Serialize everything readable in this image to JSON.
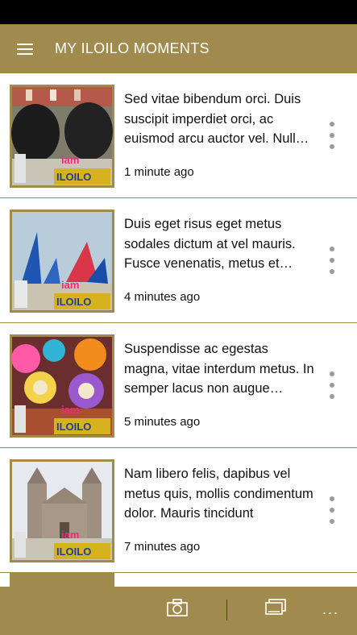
{
  "header": {
    "title": "MY ILOILO MOMENTS"
  },
  "items": [
    {
      "text": "Sed vitae bibendum orci. Duis suscipit imperdiet orci, ac euismod arcu auctor vel. Nullam pretium",
      "time": "1 minute ago",
      "theme": "bulls",
      "logo": "iam ILOILO"
    },
    {
      "text": "Duis eget risus eget metus sodales dictum at vel mauris. Fusce venenatis, metus et ultricies porta",
      "time": "4 minutes ago",
      "theme": "sails",
      "logo": "iam ILOILO"
    },
    {
      "text": "Suspendisse ac egestas magna, vitae interdum metus. In semper lacus non augue vulputate",
      "time": "5 minutes ago",
      "theme": "masks",
      "logo": "iam ILOILO"
    },
    {
      "text": "Nam libero felis, dapibus vel metus quis, mollis condimentum dolor. Mauris tincidunt",
      "time": "7 minutes ago",
      "theme": "church",
      "logo": "iam ILOILO"
    }
  ],
  "bottom_bar": {
    "camera_icon": "camera-icon",
    "gallery_icon": "gallery-icon",
    "more_label": "..."
  },
  "colors": {
    "accent": "#a08a4e"
  }
}
